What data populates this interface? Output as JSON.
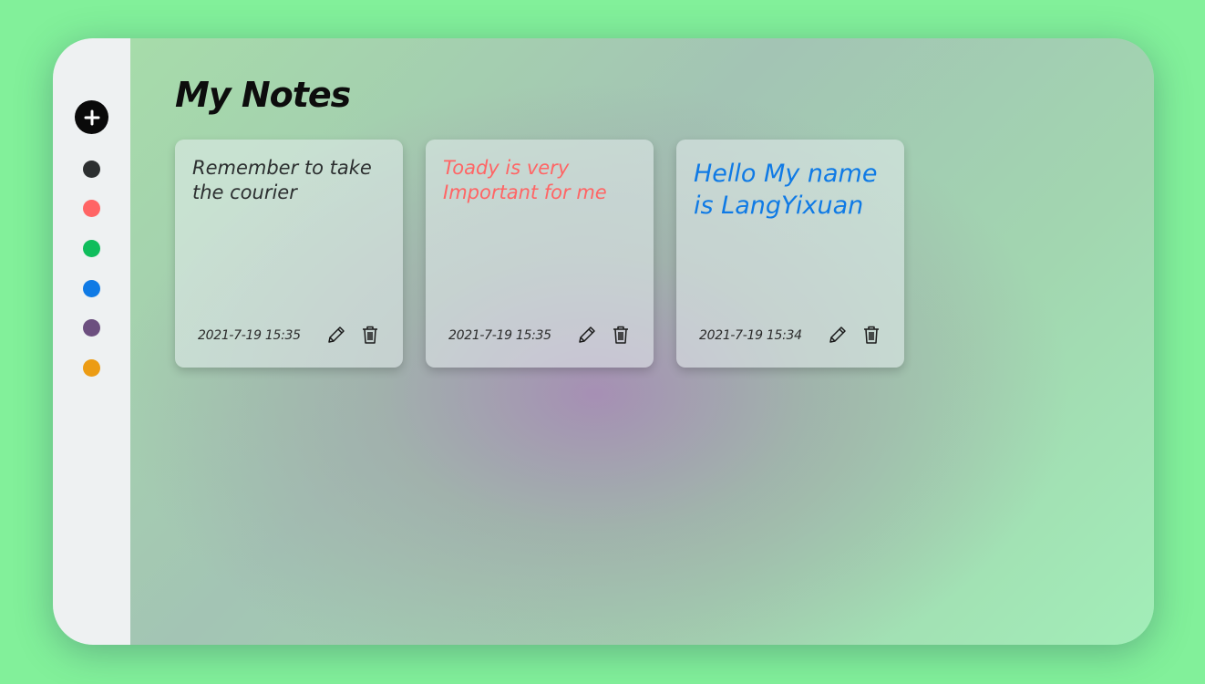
{
  "header": {
    "title": "My Notes"
  },
  "sidebar": {
    "add_button_icon": "plus-icon",
    "colors": [
      {
        "name": "dark",
        "hex": "#2c2f30"
      },
      {
        "name": "red",
        "hex": "#ff6565"
      },
      {
        "name": "green",
        "hex": "#0fbd5c"
      },
      {
        "name": "blue",
        "hex": "#0f7ae5"
      },
      {
        "name": "purple",
        "hex": "#6c4f7f"
      },
      {
        "name": "orange",
        "hex": "#ec9c14"
      }
    ]
  },
  "notes": [
    {
      "text": "Remember to take the courier",
      "date": "2021-7-19 15:35",
      "color": "#2c2f30",
      "edit_icon": "pencil-icon",
      "delete_icon": "trash-icon"
    },
    {
      "text": "Toady is very Important for me",
      "date": "2021-7-19 15:35",
      "color": "#ff6565",
      "edit_icon": "pencil-icon",
      "delete_icon": "trash-icon"
    },
    {
      "text": "Hello My name is LangYixuan",
      "date": "2021-7-19 15:34",
      "color": "#0f7ae5",
      "edit_icon": "pencil-icon",
      "delete_icon": "trash-icon"
    }
  ]
}
